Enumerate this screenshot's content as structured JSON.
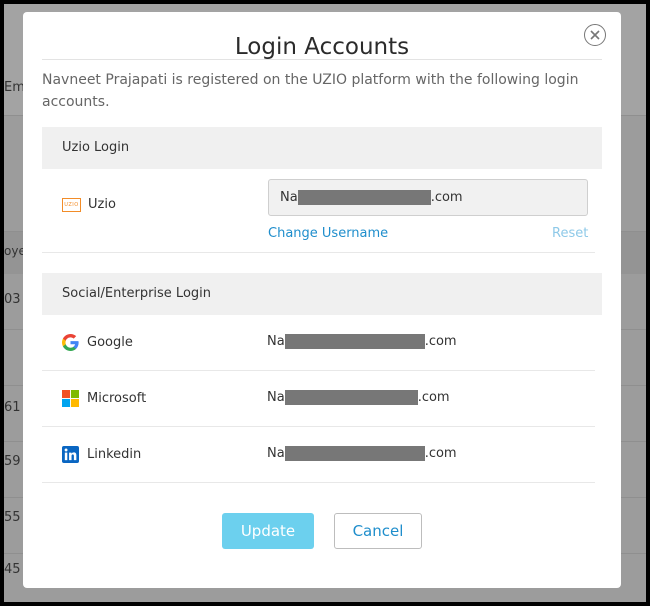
{
  "background": {
    "partial_texts": [
      "Em",
      "oye",
      "03",
      "61",
      "59",
      "55",
      "45"
    ]
  },
  "modal": {
    "title": "Login Accounts",
    "description": "Navneet Prajapati is registered on the UZIO platform with the following login accounts.",
    "uzio_section": {
      "heading": "Uzio Login",
      "provider_label": "Uzio",
      "logo_text": "UZIO",
      "username_prefix": "Na",
      "username_suffix": ".com",
      "change_label": "Change Username",
      "reset_label": "Reset"
    },
    "social_section": {
      "heading": "Social/Enterprise Login",
      "accounts": [
        {
          "provider": "Google",
          "icon": "google-icon",
          "email_prefix": "Na",
          "email_suffix": ".com"
        },
        {
          "provider": "Microsoft",
          "icon": "microsoft-icon",
          "email_prefix": "Na",
          "email_suffix": ".com"
        },
        {
          "provider": "Linkedin",
          "icon": "linkedin-icon",
          "email_prefix": "Na",
          "email_suffix": ".com"
        }
      ]
    },
    "update_label": "Update",
    "cancel_label": "Cancel"
  },
  "colors": {
    "accent": "#1f8ecc",
    "update_button": "#6cd0ee",
    "section_bg": "#f0f0f0",
    "backdrop": "#9c9c9c"
  }
}
